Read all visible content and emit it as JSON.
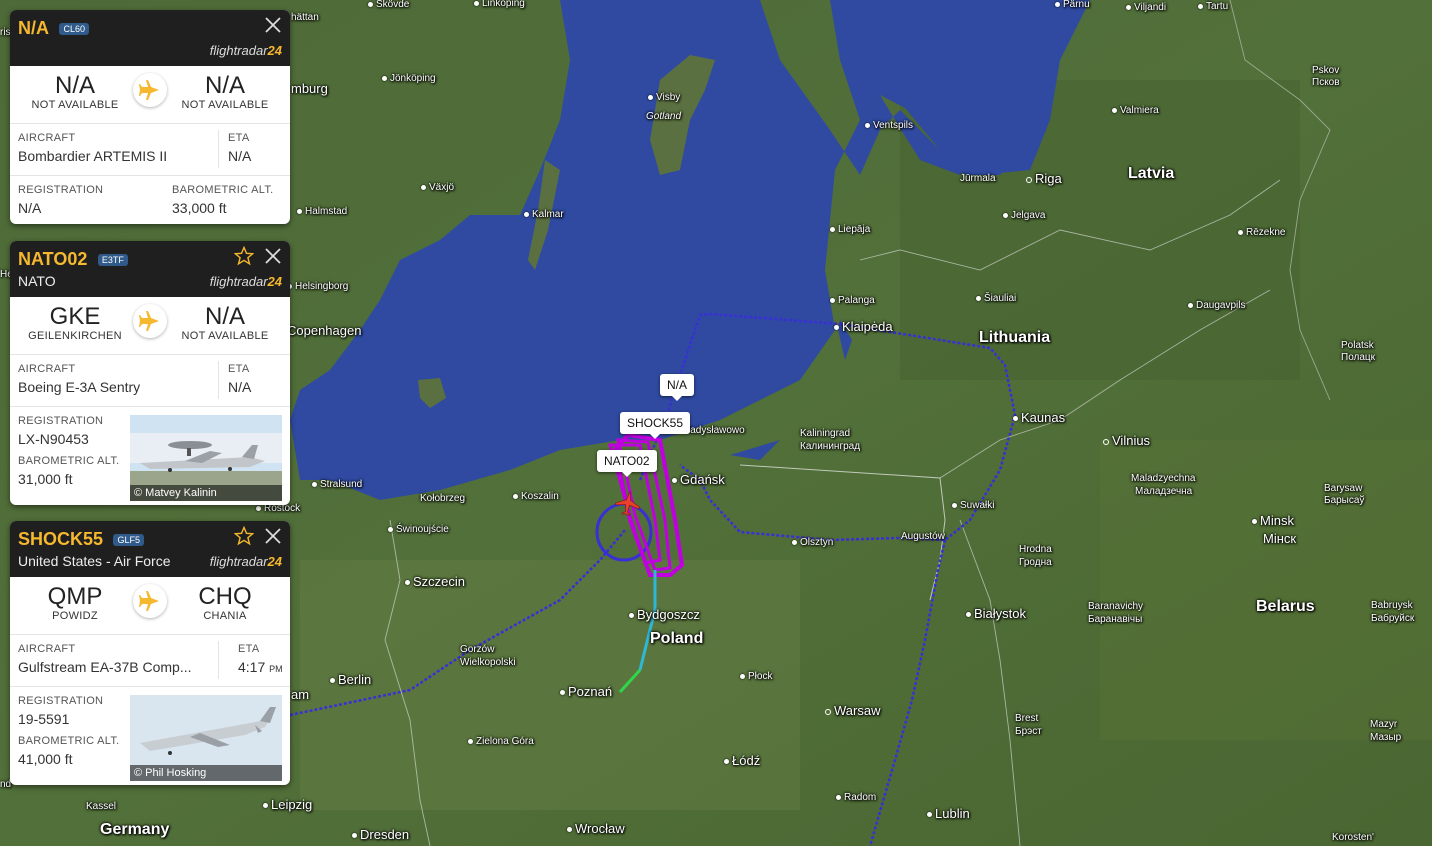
{
  "map": {
    "labels": {
      "skovde": "Skövde",
      "linkoping": "Linköping",
      "parnu": "Pärnu",
      "viljandi": "Viljandi",
      "tartu": "Tartu",
      "jonkoping": "Jönköping",
      "visby": "Visby",
      "gotland": "Gotland",
      "ventspils": "Ventspils",
      "pskov": "Pskov",
      "pskov_ru": "Псков",
      "valmiera": "Valmiera",
      "jurmala": "Jūrmala",
      "riga": "Riga",
      "latvia": "Latvia",
      "vaxjo": "Växjö",
      "halmstad": "Halmstad",
      "kalmar": "Kalmar",
      "jelgava": "Jelgava",
      "rezekne": "Rēzekne",
      "liepaja": "Liepāja",
      "helsingborg": "Helsingborg",
      "palanga": "Palanga",
      "siauliai": "Šiauliai",
      "daugavpils": "Daugavpils",
      "copenhagen": "Copenhagen",
      "klaipeda": "Klaipėda",
      "lithuania": "Lithuania",
      "polatsk": "Polatsk",
      "polatsk_by": "Полацк",
      "wladyslawowo": "ładysławowo",
      "kaunas": "Kaunas",
      "kaliningrad": "Kaliningrad",
      "kaliningrad_ru": "Калининград",
      "vilnius": "Vilnius",
      "gdansk": "Gdańsk",
      "maladzyechna": "Maladzyechna",
      "maladzyechna_by": "Маладзечна",
      "barysaw": "Barysaw",
      "barysaw_by": "Барысаў",
      "stralsund": "Stralsund",
      "kolobrzeg": "Kołobrzeg",
      "koszalin": "Koszalin",
      "suwalki": "Suwałki",
      "rostock": "Rostock",
      "swinoujscie": "Świnoujście",
      "olsztyn": "Olsztyn",
      "augustow": "Augustów",
      "minsk": "Minsk",
      "minsk_by": "Мінск",
      "hrodna": "Hrodna",
      "hrodna_by": "Гродна",
      "szczecin": "Szczecin",
      "bydgoszcz": "Bydgoszcz",
      "bialystok": "Białystok",
      "baranavichy": "Baranavichy",
      "baranavichy_by": "Баранавічы",
      "belarus": "Belarus",
      "babruysk": "Babruysk",
      "babruysk_by": "Бабруйск",
      "poland": "Poland",
      "gorzow": "Gorzów",
      "gorzow2": "Wielkopolski",
      "berlin": "Berlin",
      "plock": "Płock",
      "poznan": "Poznań",
      "warsaw": "Warsaw",
      "brest": "Brest",
      "brest_by": "Брэст",
      "mazyr": "Mazyr",
      "mazyr_by": "Мазыр",
      "zielona_gora": "Zielona Góra",
      "lodz": "Łódź",
      "kassel": "Kassel",
      "leipzig": "Leipzig",
      "radom": "Radom",
      "lublin": "Lublin",
      "germany": "Germany",
      "dresden": "Dresden",
      "wroclaw": "Wrocław",
      "korosten": "Korosten'",
      "frag_hatten": "hättan",
      "frag_burg": "mburg",
      "frag_am": "am",
      "frag_iris": "ris",
      "frag_he": "He",
      "frag_nd": "nd"
    },
    "tags": {
      "na": "N/A",
      "shock55": "SHOCK55",
      "nato02": "NATO02"
    },
    "colors": {
      "track_blue": "#3a2fd6",
      "track_magenta": "#c000e0",
      "track_cyan": "#2fb7d6",
      "track_green": "#2fd64a",
      "aircraft": "#e8412b"
    }
  },
  "panels": [
    {
      "callsign": "N/A",
      "type": "CL60",
      "operator": "",
      "brand": "flightradar",
      "brand_num": "24",
      "from_code": "N/A",
      "from_city": "NOT AVAILABLE",
      "to_code": "N/A",
      "to_city": "NOT AVAILABLE",
      "aircraft_label": "AIRCRAFT",
      "aircraft": "Bombardier ARTEMIS II",
      "eta_label": "ETA",
      "eta": "N/A",
      "reg_label": "REGISTRATION",
      "registration": "N/A",
      "alt_label": "BAROMETRIC ALT.",
      "altitude": "33,000 ft"
    },
    {
      "callsign": "NATO02",
      "type": "E3TF",
      "operator": "NATO",
      "brand": "flightradar",
      "brand_num": "24",
      "from_code": "GKE",
      "from_city": "GEILENKIRCHEN",
      "to_code": "N/A",
      "to_city": "NOT AVAILABLE",
      "aircraft_label": "AIRCRAFT",
      "aircraft": "Boeing E-3A Sentry",
      "eta_label": "ETA",
      "eta": "N/A",
      "reg_label": "REGISTRATION",
      "registration": "LX-N90453",
      "alt_label": "BAROMETRIC ALT.",
      "altitude": "31,000 ft",
      "photo_credit": "© Matvey Kalinin"
    },
    {
      "callsign": "SHOCK55",
      "type": "GLF5",
      "operator": "United States - Air Force",
      "brand": "flightradar",
      "brand_num": "24",
      "from_code": "QMP",
      "from_city": "POWIDZ",
      "to_code": "CHQ",
      "to_city": "CHANIA",
      "aircraft_label": "AIRCRAFT",
      "aircraft": "Gulfstream EA-37B Comp...",
      "eta_label": "ETA",
      "eta": "4:17",
      "eta_suffix": "PM",
      "reg_label": "REGISTRATION",
      "registration": "19-5591",
      "alt_label": "BAROMETRIC ALT.",
      "altitude": "41,000 ft",
      "photo_credit": "© Phil Hosking"
    }
  ]
}
